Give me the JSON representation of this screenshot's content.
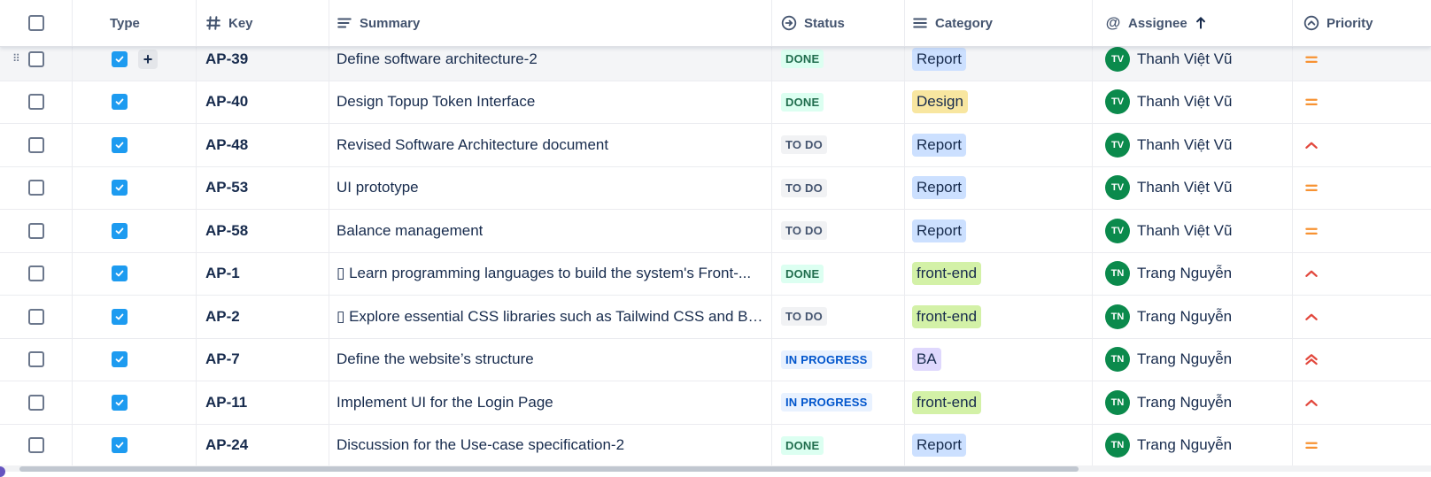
{
  "header": {
    "type_label": "Type",
    "key_label": "Key",
    "summary_label": "Summary",
    "status_label": "Status",
    "category_label": "Category",
    "assignee_label": "Assignee",
    "priority_label": "Priority"
  },
  "colors": {
    "done_bg": "#dcfff1",
    "done_fg": "#216e4e",
    "todo_bg": "#f1f2f4",
    "todo_fg": "#44546f",
    "progress_bg": "#e9f2ff",
    "progress_fg": "#0055cc",
    "report": "#cce0ff",
    "design": "#f8e6a0",
    "frontend": "#d3f1a7",
    "ba": "#dfd8fd",
    "avatar": "#0b8a4c",
    "priority_orange": "#f79232",
    "priority_red": "#e2483d"
  },
  "rows": [
    {
      "key": "AP-39",
      "summary": "Define software architecture-2",
      "status": "DONE",
      "status_kind": "done",
      "category": "Report",
      "category_kind": "report",
      "initials": "TV",
      "assignee": "Thanh Việt Vũ",
      "priority": "medium"
    },
    {
      "key": "AP-40",
      "summary": "Design Topup Token Interface",
      "status": "DONE",
      "status_kind": "done",
      "category": "Design",
      "category_kind": "design",
      "initials": "TV",
      "assignee": "Thanh Việt Vũ",
      "priority": "medium"
    },
    {
      "key": "AP-48",
      "summary": "Revised Software Architecture document",
      "status": "TO DO",
      "status_kind": "todo",
      "category": "Report",
      "category_kind": "report",
      "initials": "TV",
      "assignee": "Thanh Việt Vũ",
      "priority": "high"
    },
    {
      "key": "AP-53",
      "summary": "UI prototype",
      "status": "TO DO",
      "status_kind": "todo",
      "category": "Report",
      "category_kind": "report",
      "initials": "TV",
      "assignee": "Thanh Việt Vũ",
      "priority": "medium"
    },
    {
      "key": "AP-58",
      "summary": "Balance management",
      "status": "TO DO",
      "status_kind": "todo",
      "category": "Report",
      "category_kind": "report",
      "initials": "TV",
      "assignee": "Thanh Việt Vũ",
      "priority": "medium"
    },
    {
      "key": "AP-1",
      "summary": "▯ Learn programming languages to build the system's Front-...",
      "status": "DONE",
      "status_kind": "done",
      "category": "front-end",
      "category_kind": "frontend",
      "initials": "TN",
      "assignee": "Trang Nguyễn",
      "priority": "high"
    },
    {
      "key": "AP-2",
      "summary": "▯ Explore essential CSS libraries such as Tailwind CSS and Bo...",
      "status": "TO DO",
      "status_kind": "todo",
      "category": "front-end",
      "category_kind": "frontend",
      "initials": "TN",
      "assignee": "Trang Nguyễn",
      "priority": "high"
    },
    {
      "key": "AP-7",
      "summary": "Define the website’s structure",
      "status": "IN PROGRESS",
      "status_kind": "progress",
      "category": "BA",
      "category_kind": "ba",
      "initials": "TN",
      "assignee": "Trang Nguyễn",
      "priority": "highest"
    },
    {
      "key": "AP-11",
      "summary": "Implement UI for the Login Page",
      "status": "IN PROGRESS",
      "status_kind": "progress",
      "category": "front-end",
      "category_kind": "frontend",
      "initials": "TN",
      "assignee": "Trang Nguyễn",
      "priority": "high"
    },
    {
      "key": "AP-24",
      "summary": "Discussion for the Use-case specification-2",
      "status": "DONE",
      "status_kind": "done",
      "category": "Report",
      "category_kind": "report",
      "initials": "TN",
      "assignee": "Trang Nguyễn",
      "priority": "medium"
    }
  ]
}
